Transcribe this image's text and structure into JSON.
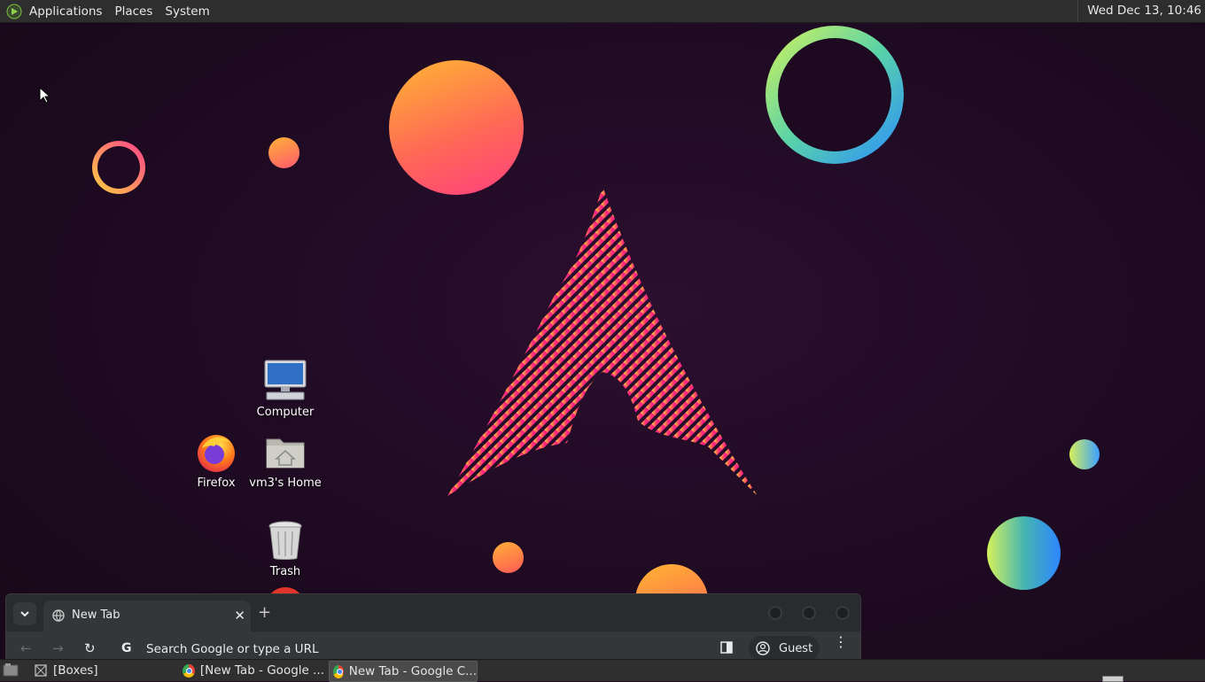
{
  "top_panel": {
    "menus": [
      "Applications",
      "Places",
      "System"
    ],
    "clock": "Wed Dec 13, 10:46"
  },
  "desktop_icons": {
    "computer": "Computer",
    "firefox": "Firefox",
    "home": "vm3's Home",
    "trash": "Trash"
  },
  "browser": {
    "tab_title": "New Tab",
    "omnibox_placeholder": "Search Google or type a URL",
    "profile_label": "Guest"
  },
  "taskbar": {
    "tasks": [
      "[Boxes]",
      "[New Tab - Google ...",
      "New Tab - Google C..."
    ]
  },
  "icons": [
    "applications-menu-icon",
    "computer-icon",
    "firefox-icon",
    "home-folder-icon",
    "trash-icon",
    "chrome-icon",
    "globe-icon",
    "back-icon",
    "forward-icon",
    "reload-icon",
    "google-icon",
    "side-panel-icon",
    "profile-icon",
    "more-menu-icon",
    "show-desktop-icon"
  ]
}
